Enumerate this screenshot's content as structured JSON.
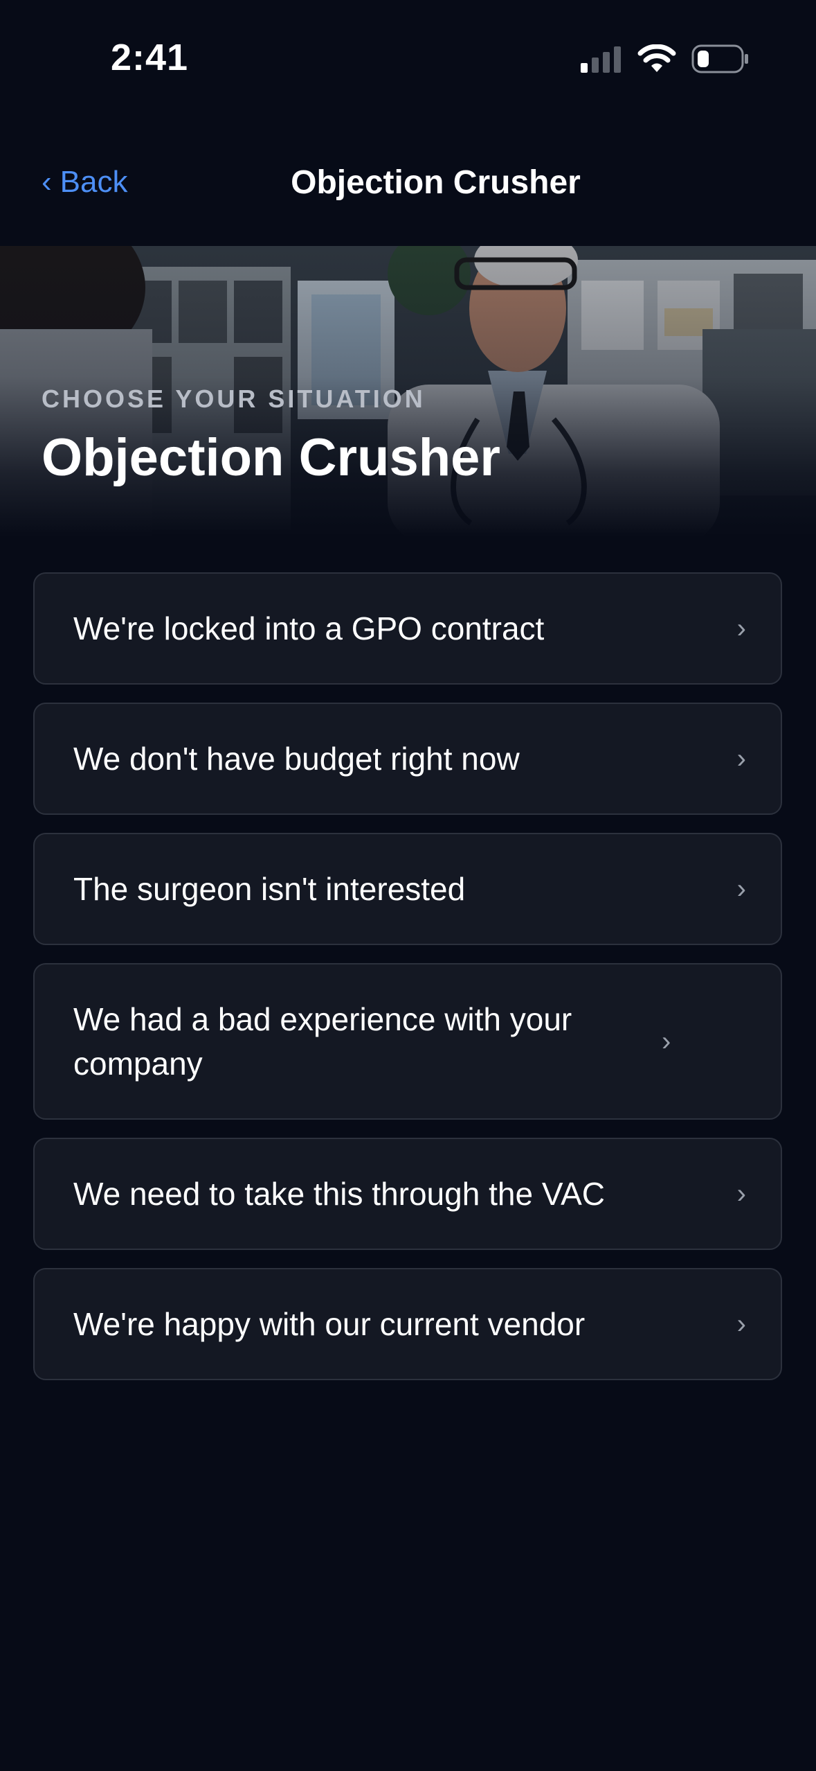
{
  "status_bar": {
    "time": "2:41"
  },
  "nav": {
    "back_label": "Back",
    "back_chevron": "‹",
    "title": "Objection Crusher"
  },
  "hero": {
    "eyebrow": "CHOOSE YOUR SITUATION",
    "title": "Objection Crusher"
  },
  "options": [
    {
      "label": "We're locked into a GPO contract"
    },
    {
      "label": "We don't have budget right now"
    },
    {
      "label": "The surgeon isn't interested"
    },
    {
      "label": "We had a bad experience with your company"
    },
    {
      "label": "We need to take this through the VAC"
    },
    {
      "label": "We're happy with our current vendor"
    }
  ],
  "chevron_glyph": "›",
  "colors": {
    "background": "#070b17",
    "accent": "#4d8ff5",
    "card": "#141823",
    "card_border": "#2c313d"
  }
}
